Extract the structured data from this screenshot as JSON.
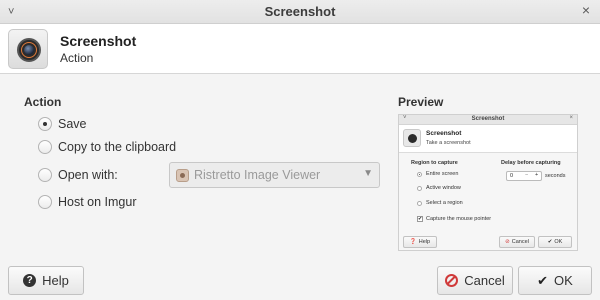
{
  "window": {
    "title": "Screenshot",
    "close_glyph": "×",
    "minimize_glyph": "˅"
  },
  "header": {
    "title": "Screenshot",
    "subtitle": "Action",
    "icon": "camera-lens-icon"
  },
  "action": {
    "section_title": "Action",
    "options": [
      {
        "label": "Save",
        "selected": true
      },
      {
        "label": "Copy to the clipboard",
        "selected": false
      },
      {
        "label": "Open with:",
        "selected": false
      },
      {
        "label": "Host on Imgur",
        "selected": false
      }
    ],
    "open_with_app": "Ristretto Image Viewer",
    "dropdown_glyph": "▼"
  },
  "preview": {
    "section_title": "Preview",
    "window_title": "Screenshot",
    "header_title": "Screenshot",
    "header_subtitle": "Take a screenshot",
    "region_title": "Region to capture",
    "regions": [
      "Entire screen",
      "Active window",
      "Select a region"
    ],
    "region_selected_index": 0,
    "delay_title": "Delay before capturing",
    "delay_value": "0",
    "delay_unit": "seconds",
    "mouse_pointer_label": "Capture the mouse pointer",
    "mouse_pointer_checked": true,
    "help_label": "Help",
    "cancel_label": "Cancel",
    "ok_label": "OK"
  },
  "buttons": {
    "help_label": "Help",
    "cancel_label": "Cancel",
    "ok_label": "OK"
  },
  "colors": {
    "cancel_icon": "#d03a3a",
    "background": "#f4f4f4"
  }
}
